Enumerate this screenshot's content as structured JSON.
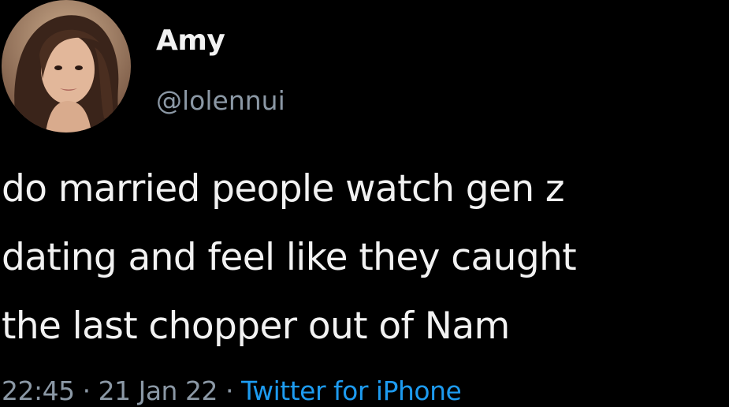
{
  "tweet": {
    "author": {
      "display_name": "Amy",
      "handle": "@lolennui",
      "avatar": "profile-photo"
    },
    "text": "do married people watch gen z\ndating and feel like they caught\nthe last chopper out of Nam",
    "time": "22:45",
    "date": "21 Jan 22",
    "separator": "·",
    "source": "Twitter for iPhone"
  },
  "colors": {
    "background": "#000000",
    "primary_text": "#f2f2f2",
    "secondary_text": "#8b98a5",
    "link": "#1d9bf0"
  }
}
